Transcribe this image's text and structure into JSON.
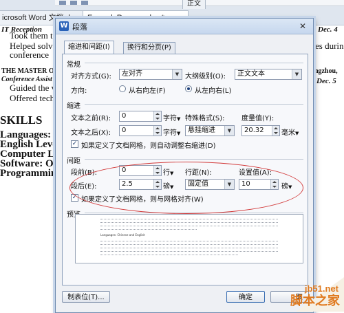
{
  "background": {
    "tabs": [
      {
        "label": "icrosoft Word 文档.docx"
      },
      {
        "label": "ExampleResume.doc *"
      },
      {
        "label": "正文"
      }
    ],
    "doc_lines": [
      {
        "text": "IT Reception",
        "style": "it"
      },
      {
        "text": "Took them t",
        "style": "ln"
      },
      {
        "text": "Helped solv",
        "style": "ln"
      },
      {
        "text": "conference",
        "style": "ln"
      },
      {
        "text": "THE MASTER OF E",
        "style": "b"
      },
      {
        "text": "Conference Assist",
        "style": "it"
      },
      {
        "text": "Guided the v",
        "style": "ln"
      },
      {
        "text": "Offered tech",
        "style": "ln"
      },
      {
        "text": "SKILLS",
        "style": "skh"
      },
      {
        "text": "Languages: C",
        "style": "sk"
      },
      {
        "text": "English Leve",
        "style": "sk"
      },
      {
        "text": "Computer Le",
        "style": "sk"
      },
      {
        "text": "Software: Of",
        "style": "sk"
      },
      {
        "text": "Programmin",
        "style": "sk"
      }
    ],
    "right_fragments": [
      {
        "text": "Dec. 4"
      },
      {
        "text": "es durin"
      },
      {
        "text": "ngzhou,"
      },
      {
        "text": "Dec. 5"
      }
    ]
  },
  "dialog": {
    "icon": "W",
    "title": "段落",
    "close_glyph": "✕",
    "tabs": [
      {
        "label": "缩进和间距(I)",
        "active": true
      },
      {
        "label": "换行和分页(P)",
        "active": false
      }
    ],
    "general": {
      "heading": "常规",
      "alignment_label": "对齐方式(G):",
      "alignment_value": "左对齐",
      "outline_label": "大纲级别(O):",
      "outline_value": "正文文本",
      "direction_label": "方向:",
      "rtl_option": "从右向左(F)",
      "ltr_option": "从左向右(L)",
      "direction_selected": "从左向右(L)"
    },
    "indent": {
      "heading": "缩进",
      "before_label": "文本之前(R):",
      "before_value": "0",
      "before_unit": "字符",
      "after_label": "文本之后(X):",
      "after_value": "0",
      "after_unit": "字符",
      "special_label": "特殊格式(S):",
      "special_value": "悬挂缩进",
      "measure_label": "度量值(Y):",
      "measure_value": "20.32",
      "measure_unit": "毫米",
      "grid_indent_check": "如果定义了文档网格，则自动调整右缩进(D)",
      "grid_indent_checked": true
    },
    "spacing": {
      "heading": "间距",
      "before_label": "段前(B):",
      "before_value": "0",
      "before_unit": "行",
      "after_label": "段后(E):",
      "after_value": "2.5",
      "after_unit": "磅",
      "line_label": "行距(N):",
      "line_value": "固定值",
      "setting_label": "设置值(A):",
      "setting_value": "10",
      "setting_unit": "磅",
      "grid_snap_check": "如果定义了文档网格，则与网格对齐(W)",
      "grid_snap_checked": true
    },
    "preview": {
      "heading": "预览",
      "sample_text": "Languages: Chinese and English"
    },
    "buttons": {
      "tabs": "制表位(T)...",
      "ok": "确定",
      "cancel": "取"
    }
  },
  "watermark": {
    "url": "jb51.net",
    "name": "脚本之家"
  },
  "colors": {
    "highlight_ellipse": "#d23a3a",
    "watermark": "#e07a1f",
    "dialog_bg": "#eef0f4"
  }
}
